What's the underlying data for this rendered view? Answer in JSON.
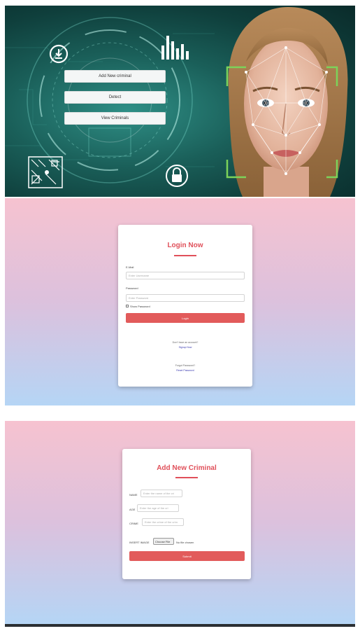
{
  "hero": {
    "buttons": [
      "Add New criminal",
      "Detect",
      "View Criminals"
    ],
    "icons": [
      "download-icon",
      "bar-chart-icon",
      "qr-code-icon",
      "lock-icon"
    ],
    "colors": {
      "teal_dark": "#0f3f3c",
      "teal_light": "#2f8f86",
      "scan_green": "#7cd35a"
    }
  },
  "login": {
    "title": "Login Now",
    "email_label": "E-Mail",
    "email_placeholder": "Enter Username",
    "password_label": "Password",
    "password_placeholder": "Enter Password",
    "show_password_label": "Show Password",
    "login_button": "Login",
    "no_account_text": "Don't have an account?",
    "signup_link": "Signup Now",
    "forgot_text": "Forgot Password?",
    "reset_link": "Reset Password"
  },
  "criminal": {
    "title": "Add New Criminal",
    "name_label": "NAME",
    "name_placeholder": "Enter the name of the cri",
    "age_label": "AGE",
    "age_placeholder": "Enter the age of the cri",
    "crime_label": "CRIME",
    "crime_placeholder": "Enter the crime of the crim",
    "image_label": "INSERT IMAGE",
    "choose_file": "Choose File",
    "no_file": "No file chosen",
    "submit_button": "Submit"
  },
  "colors": {
    "accent": "#e0505a",
    "button_red": "#e25b5b",
    "grad_top": "#f6c2d0",
    "grad_bottom": "#b5d5f5"
  }
}
